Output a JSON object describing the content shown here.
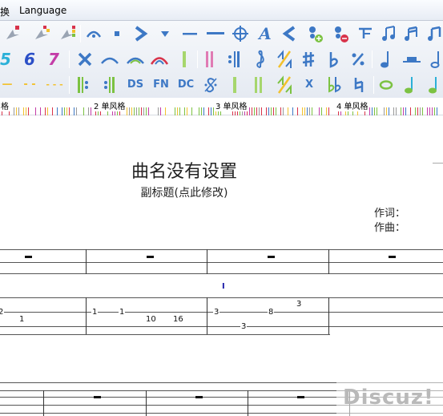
{
  "menubar": {
    "items": [
      "换",
      "Language"
    ]
  },
  "toolbar": {
    "row2": {
      "num5": "5",
      "num6": "6",
      "num7": "7"
    },
    "row3": {
      "dash1": "—",
      "dash2": "- -",
      "dash3": "- - -",
      "ds": "DS",
      "fn": "FN",
      "dc": "DC",
      "x": "X"
    },
    "row1": {
      "text_a": "A"
    }
  },
  "ruler": {
    "labels": [
      "格",
      "2 单风格",
      "3 单风格",
      "4 单风格"
    ]
  },
  "score": {
    "title": "曲名没有设置",
    "subtitle": "副标题(点此修改)",
    "lyricist": "作词：",
    "composer": "作曲：",
    "cursor": "I",
    "tab_frets": [
      "2",
      "1",
      "1",
      "1",
      "10",
      "16",
      "3",
      "8",
      "3",
      "3"
    ]
  },
  "watermark": "Discuz!",
  "colors": {
    "accent_blue": "#3d78c5",
    "accent_green": "#7cc242",
    "accent_red": "#d8334a",
    "accent_magenta": "#c43da8"
  }
}
